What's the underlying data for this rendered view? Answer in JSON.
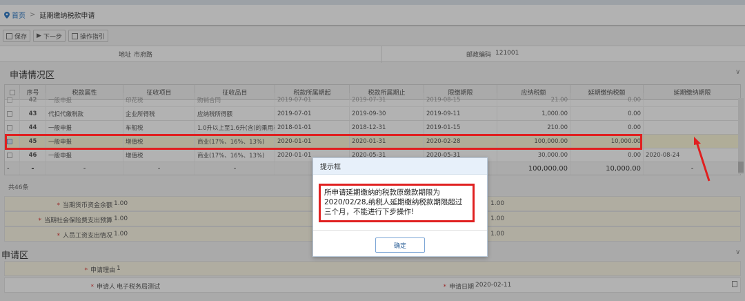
{
  "breadcrumb": {
    "home": "首页",
    "separator": ">",
    "current": "延期缴纳税款申请"
  },
  "toolbar": {
    "save": "保存",
    "next": "下一步",
    "guide": "操作指引"
  },
  "address": {
    "label": "地址",
    "value": "市府路",
    "postcode_label": "邮政编码",
    "postcode_value": "121001"
  },
  "section1": {
    "title": "申请情况区"
  },
  "table": {
    "headers": [
      "",
      "序号",
      "税款属性",
      "征收项目",
      "征收品目",
      "税款所属期起",
      "税款所属期止",
      "限缴期限",
      "应纳税额",
      "延期缴纳税额",
      "延期缴纳期限"
    ],
    "rows": [
      {
        "no": "42",
        "attr": "一般申报",
        "item": "印花税",
        "sub": "购销合同",
        "start": "2019-07-01",
        "end": "2019-07-31",
        "deadline": "2019-08-15",
        "tax": "21.00",
        "defer": "0.00",
        "deferdate": ""
      },
      {
        "no": "43",
        "attr": "代扣代缴税款",
        "item": "企业所得税",
        "sub": "应纳税所得额",
        "start": "2019-07-01",
        "end": "2019-09-30",
        "deadline": "2019-09-11",
        "tax": "1,000.00",
        "defer": "0.00",
        "deferdate": ""
      },
      {
        "no": "44",
        "attr": "一般申报",
        "item": "车船税",
        "sub": "1.0升以上至1.6升(含)的乘用车",
        "start": "2018-01-01",
        "end": "2018-12-31",
        "deadline": "2019-01-15",
        "tax": "210.00",
        "defer": "0.00",
        "deferdate": ""
      },
      {
        "no": "45",
        "attr": "一般申报",
        "item": "增值税",
        "sub": "商业(17%、16%、13%)",
        "start": "2020-01-01",
        "end": "2020-01-31",
        "deadline": "2020-02-28",
        "tax": "100,000.00",
        "defer": "10,000.00",
        "deferdate": ""
      },
      {
        "no": "46",
        "attr": "一般申报",
        "item": "增值税",
        "sub": "商业(17%、16%、13%)",
        "start": "2020-01-01",
        "end": "2020-05-31",
        "deadline": "2020-05-31",
        "tax": "30,000.00",
        "defer": "0.00",
        "deferdate": "2020-08-24"
      }
    ],
    "total": {
      "dash": "-",
      "tax": "100,000.00",
      "defer": "10,000.00"
    },
    "count_text": "共46条"
  },
  "form1": [
    {
      "label": "当期货币资金余额",
      "value": "1.00",
      "right_value": "1.00"
    },
    {
      "label": "当期社会保险费支出预算",
      "value": "1.00",
      "right_value": "1.00"
    },
    {
      "label": "人员工资支出情况",
      "value": "1.00",
      "right_value": "1.00"
    }
  ],
  "section2": {
    "title": "申请区"
  },
  "form2": {
    "reason_label": "申请理由",
    "reason_value": "1",
    "applicant_label": "申请人",
    "applicant_value": "电子税务局测试",
    "date_label": "申请日期",
    "date_value": "2020-02-11"
  },
  "modal": {
    "title": "提示框",
    "message": "所申请延期缴纳的税款原缴款期限为2020/02/28,纳税人延期缴纳税款期限超过三个月，不能进行下步操作!",
    "confirm": "确定"
  },
  "colors": {
    "highlight_red": "#e02020",
    "link_blue": "#2b78c5",
    "modal_header": "#e7f0fa"
  }
}
